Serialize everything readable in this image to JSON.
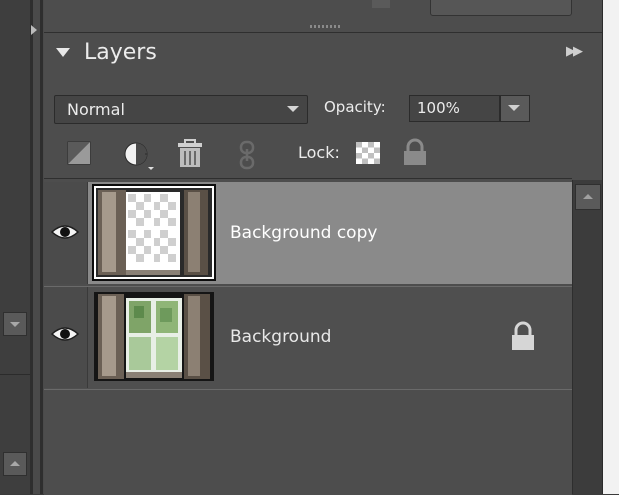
{
  "panel": {
    "title": "Layers"
  },
  "blend_mode": {
    "selected": "Normal"
  },
  "opacity": {
    "label": "Opacity:",
    "value": "100%"
  },
  "tools": {
    "lock_label": "Lock:"
  },
  "layers": [
    {
      "name": "Background copy",
      "visible": true,
      "selected": true,
      "locked": false
    },
    {
      "name": "Background",
      "visible": true,
      "selected": false,
      "locked": true
    }
  ],
  "colors": {
    "panel_bg": "#4d4d4d",
    "selected_row": "#8a8a8a",
    "text": "#ececec"
  },
  "icons": {
    "header_collapse": "triangle-down-icon",
    "panel_menu": "double-chevron-right-icon",
    "new_layer": "new-layer-icon",
    "adjustment": "adjustment-layer-icon",
    "delete": "trash-icon",
    "link": "link-icon",
    "lock_transparent": "checkerboard-icon",
    "lock_all": "padlock-icon",
    "visibility": "eye-icon"
  }
}
